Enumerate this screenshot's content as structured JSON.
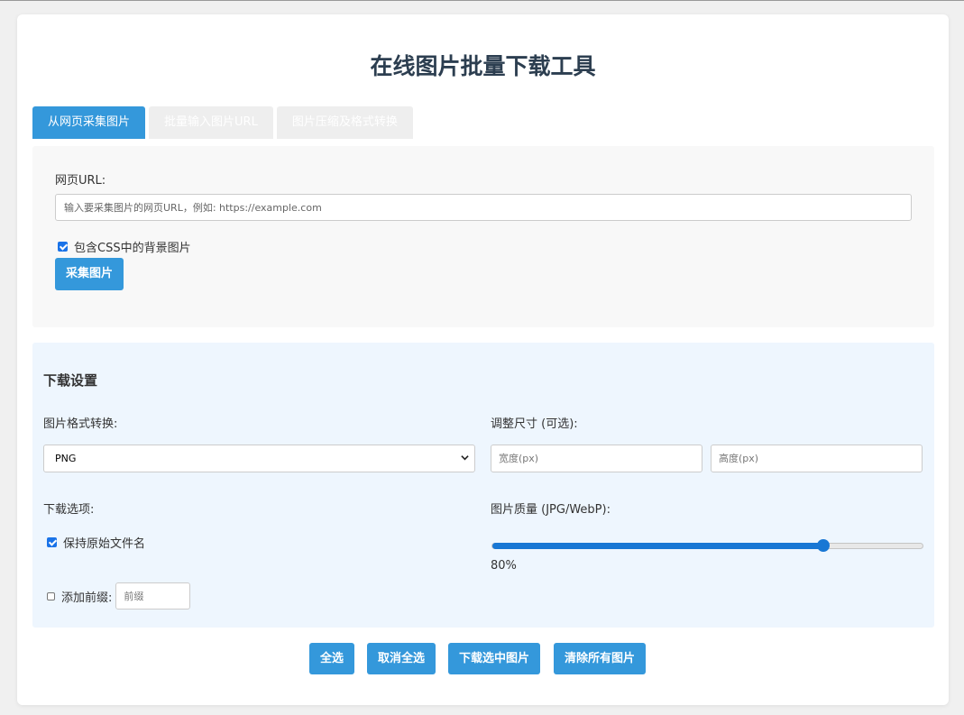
{
  "title": "在线图片批量下载工具",
  "tabs": [
    {
      "label": "从网页采集图片",
      "active": true
    },
    {
      "label": "批量输入图片URL",
      "active": false
    },
    {
      "label": "图片压缩及格式转换",
      "active": false
    }
  ],
  "collect": {
    "url_label": "网页URL:",
    "url_placeholder": "输入要采集图片的网页URL，例如: https://example.com",
    "url_value": "",
    "css_bg_label": "包含CSS中的背景图片",
    "css_bg_checked": true,
    "collect_button": "采集图片"
  },
  "settings": {
    "heading": "下载设置",
    "format_label": "图片格式转换:",
    "format_selected": "PNG",
    "resize_label": "调整尺寸 (可选):",
    "width_placeholder": "宽度(px)",
    "height_placeholder": "高度(px)",
    "options_label": "下载选项:",
    "keep_name_label": "保持原始文件名",
    "keep_name_checked": true,
    "prefix_label": "添加前缀:",
    "prefix_checked": false,
    "prefix_placeholder": "前缀",
    "quality_label": "图片质量 (JPG/WebP):",
    "quality_value": 80,
    "quality_text": "80%"
  },
  "actions": {
    "select_all": "全选",
    "deselect_all": "取消全选",
    "download_selected": "下载选中图片",
    "clear_all": "清除所有图片"
  },
  "colors": {
    "accent": "#3498db",
    "title": "#2c3e50",
    "settings_bg": "#eef6fe"
  }
}
